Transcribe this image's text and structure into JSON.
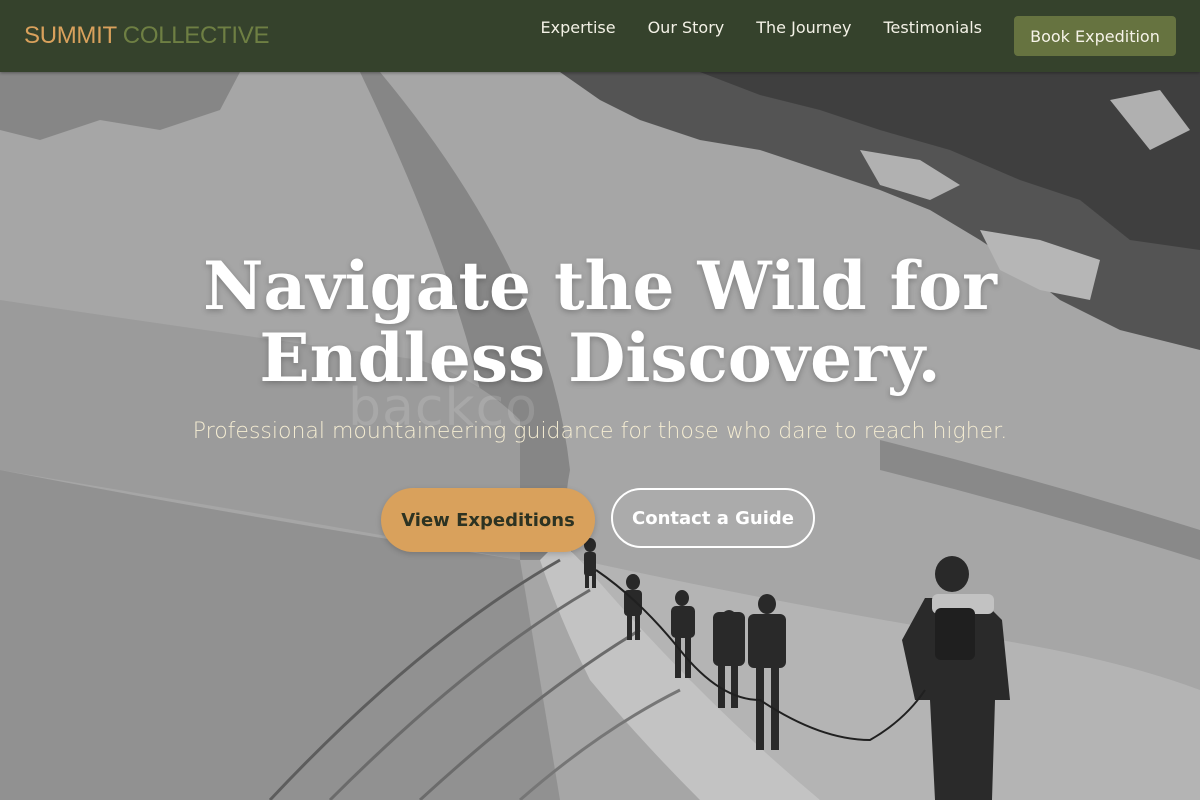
{
  "brand": {
    "part1": "SUMMIT",
    "part2": "COLLECTIVE",
    "accent_color": "#d9a15c",
    "secondary_color": "#6e7f43"
  },
  "nav": {
    "links": [
      "Expertise",
      "Our Story",
      "The Journey",
      "Testimonials"
    ],
    "cta_label": "Book Expedition"
  },
  "hero": {
    "watermark": "backco",
    "headline_line1": "Navigate the Wild for",
    "headline_line2": "Endless Discovery.",
    "subheadline": "Professional mountaineering guidance for those who dare to reach higher.",
    "primary_cta": "View Expeditions",
    "secondary_cta": "Contact a Guide",
    "background": "monochrome mountain ridge with roped climbers"
  },
  "colors": {
    "navbar": "#2c3a22",
    "button_olive": "#667340",
    "button_tan": "#d9a15c",
    "subheadline": "#f4ecd2"
  }
}
